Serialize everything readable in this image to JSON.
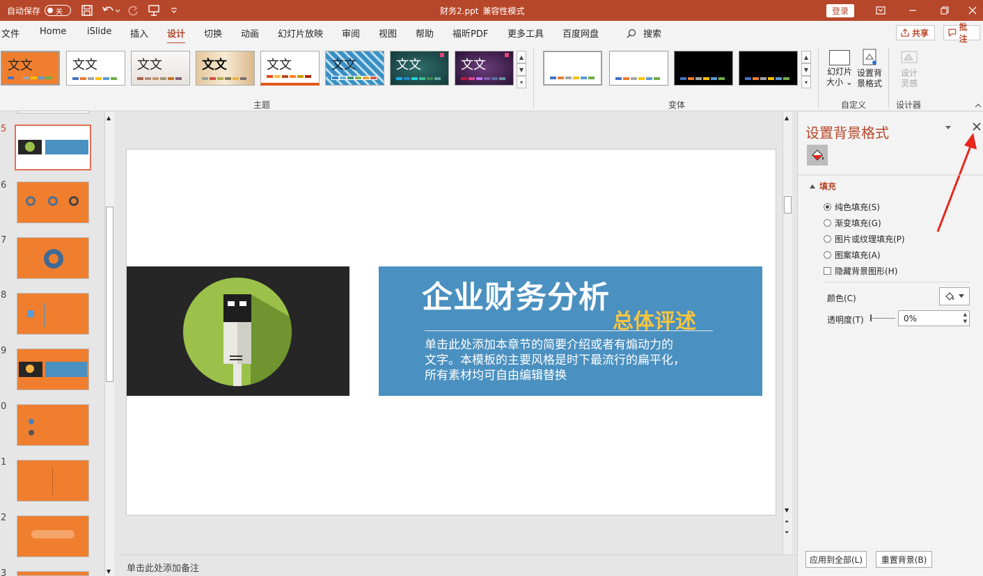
{
  "titlebar": {
    "autosave_label": "自动保存",
    "autosave_state": "关",
    "filename": "财务2.ppt",
    "mode": "兼容性模式",
    "login": "登录"
  },
  "menu": {
    "tabs": [
      "文件",
      "Home",
      "iSlide",
      "插入",
      "设计",
      "切换",
      "动画",
      "幻灯片放映",
      "审阅",
      "视图",
      "帮助",
      "福昕PDF",
      "更多工具",
      "百度网盘"
    ],
    "active": "设计",
    "search": "搜索",
    "share": "共享",
    "comment": "批注"
  },
  "ribbon": {
    "theme_label": "文文",
    "group_themes": "主题",
    "group_variants": "变体",
    "group_custom": "自定义",
    "group_designer": "设计器",
    "slide_size_line1": "幻灯片",
    "slide_size_line2": "大小",
    "format_bg_line1": "设置背",
    "format_bg_line2": "景格式",
    "design_ideas_line1": "设计",
    "design_ideas_line2": "灵感"
  },
  "thumbnails": {
    "numbers": [
      "5",
      "6",
      "7",
      "8",
      "9",
      "0",
      "1",
      "2",
      "3"
    ],
    "current": "5"
  },
  "slide": {
    "title": "企业财务分析",
    "subtitle": "总体评述",
    "body_line1": "单击此处添加本章节的简要介绍或者有煽动力的",
    "body_line2": "文字。本模板的主要风格是时下最流行的扁平化，",
    "body_line3": "所有素材均可自由编辑替换"
  },
  "notes": {
    "placeholder": "单击此处添加备注"
  },
  "pane": {
    "title": "设置背景格式",
    "section_fill": "填充",
    "solid": "纯色填充(S)",
    "gradient": "渐变填充(G)",
    "picture": "图片或纹理填充(P)",
    "pattern": "图案填充(A)",
    "hide_bg": "隐藏背景图形(H)",
    "color_label": "颜色(C)",
    "transparency_label": "透明度(T)",
    "transparency_value": "0%",
    "apply_all": "应用到全部(L)",
    "reset": "重置背景(B)"
  },
  "colors": {
    "accent": "#b7472a",
    "slide_orange": "#ef7f2f",
    "banner_blue": "#4a90c0",
    "subtitle_yellow": "#f5c542"
  }
}
